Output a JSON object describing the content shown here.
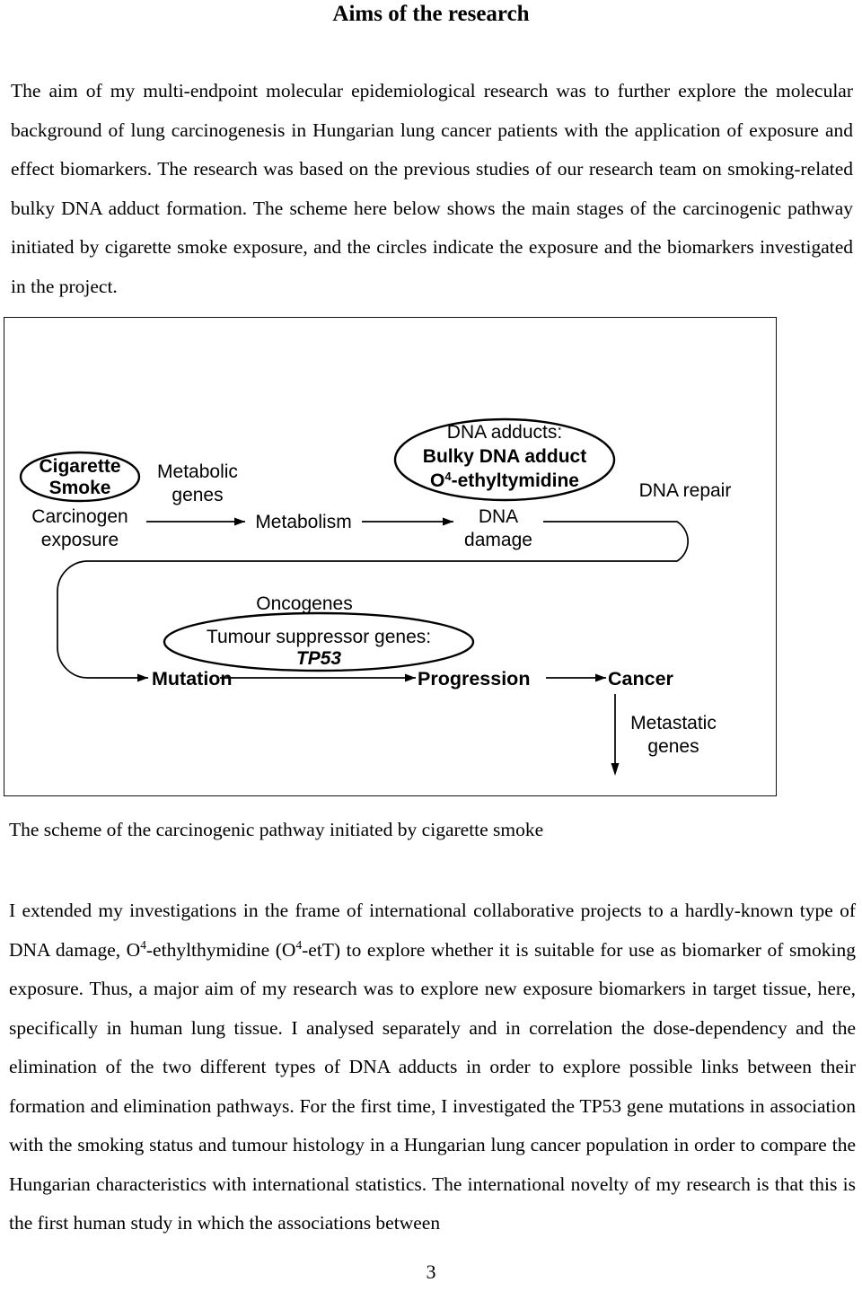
{
  "document": {
    "title": "Aims of the research",
    "page_number": "3"
  },
  "paragraphs": {
    "intro": "The aim of my multi-endpoint molecular epidemiological research was to further explore the molecular background of lung carcinogenesis in Hungarian lung cancer patients with the application of exposure and effect biomarkers. The research was based on the previous studies of our research team on smoking-related bulky DNA adduct formation. The scheme here below shows the main stages of the carcinogenic pathway initiated by cigarette smoke exposure, and the circles indicate the exposure and the biomarkers investigated in the project.",
    "body_part1": "I extended my investigations in the frame of international collaborative projects to a hardly-known type of DNA damage, O",
    "body_sup1": "4",
    "body_part2": "-ethylthymidine (O",
    "body_sup2": "4",
    "body_part3": "-etT) to explore whether it is suitable for use as biomarker of smoking exposure. Thus, a major aim of my research was to explore new exposure biomarkers in target tissue, here, specifically in human lung tissue. I analysed separately and in correlation the dose-dependency and the elimination of the two different types of DNA adducts in order to explore possible links between their formation and elimination pathways. For the first time, I investigated the TP53 gene mutations in association with the smoking status and tumour histology in a Hungarian lung cancer population in order to compare the Hungarian characteristics with international statistics. The international novelty of my research is that this is the first human study in which the associations between"
  },
  "figure": {
    "caption": "The scheme of the carcinogenic pathway initiated by cigarette smoke",
    "nodes": {
      "cigarette_smoke_line1": "Cigarette",
      "cigarette_smoke_line2": "Smoke",
      "carcinogen_line1": "Carcinogen",
      "carcinogen_line2": "exposure",
      "metabolic_genes_line1": "Metabolic",
      "metabolic_genes_line2": "genes",
      "metabolism": "Metabolism",
      "dna_adducts_label": "DNA adducts:",
      "bulky_dna_adduct": "Bulky DNA adduct",
      "ethyltymidine_prefix": "O",
      "ethyltymidine_sup": "4",
      "ethyltymidine_rest": "-ethyltymidine",
      "dna_damage_line1": "DNA",
      "dna_damage_line2": "damage",
      "dna_repair": "DNA repair",
      "oncogenes": "Oncogenes",
      "tumour_suppressor": "Tumour suppressor   genes:",
      "tp53": "TP53",
      "mutation": "Mutation",
      "progression": "Progression",
      "cancer": "Cancer",
      "metastatic_line1": "Metastatic",
      "metastatic_line2": "genes"
    }
  },
  "colors": {
    "text": "#000000",
    "background": "#ffffff",
    "stroke": "#111111"
  }
}
